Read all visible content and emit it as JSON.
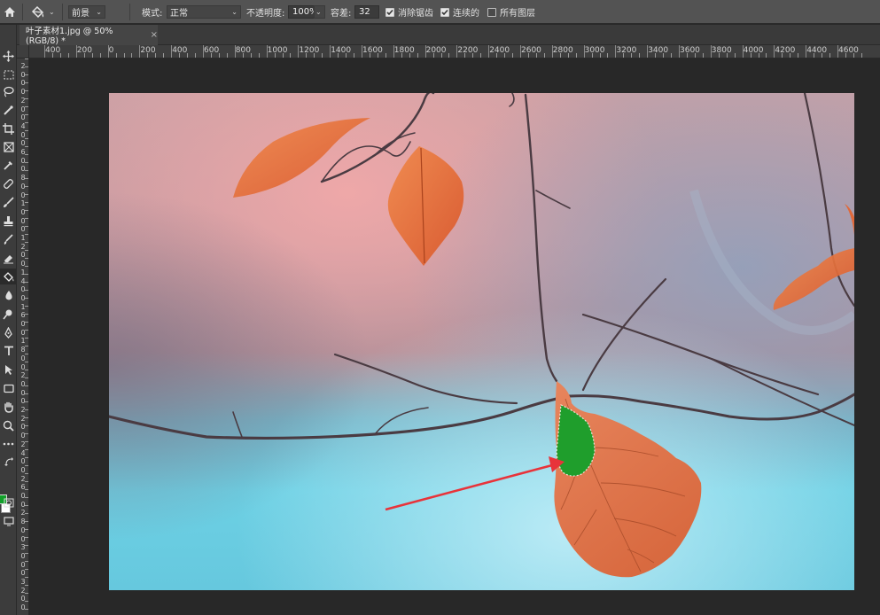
{
  "options_bar": {
    "home_icon": "home-icon",
    "tool_icon": "paint-bucket-icon",
    "fill_source": "前景",
    "mode_label": "模式:",
    "mode_value": "正常",
    "opacity_label": "不透明度:",
    "opacity_value": "100%",
    "tolerance_label": "容差:",
    "tolerance_value": "32",
    "anti_alias_label": "消除锯齿",
    "anti_alias_checked": true,
    "contiguous_label": "连续的",
    "contiguous_checked": true,
    "all_layers_label": "所有图层",
    "all_layers_checked": false
  },
  "document_tab": {
    "title": "叶子素材1.jpg @ 50%(RGB/8) *",
    "close": "×"
  },
  "ruler_h": [
    "400",
    "200",
    "0",
    "200",
    "400",
    "600",
    "800",
    "1000",
    "1200",
    "1400",
    "1600",
    "1800",
    "2000",
    "2200",
    "2400",
    "2600",
    "2800",
    "3000",
    "3200",
    "3400",
    "3600",
    "3800",
    "4000",
    "4200",
    "4400",
    "4600"
  ],
  "ruler_v": [
    "2",
    "0",
    "0",
    "0",
    "2",
    "0",
    "0",
    "4",
    "0",
    "0",
    "6",
    "0",
    "0",
    "8",
    "0",
    "0",
    "1",
    "0",
    "0",
    "0",
    "1",
    "2",
    "0",
    "0",
    "1",
    "4",
    "0",
    "0",
    "1",
    "6",
    "0",
    "0",
    "1",
    "8",
    "0",
    "0",
    "2",
    "0",
    "0",
    "0",
    "2",
    "2",
    "0",
    "0",
    "2",
    "4",
    "0",
    "0",
    "2",
    "6",
    "0",
    "0",
    "2",
    "8",
    "0",
    "0",
    "3",
    "0",
    "0",
    "0",
    "3",
    "2",
    "0",
    "0"
  ],
  "toolbar": {
    "tools": [
      "move-icon",
      "marquee-icon",
      "lasso-icon",
      "quick-select-icon",
      "crop-icon",
      "frame-icon",
      "eyedropper-icon",
      "healing-brush-icon",
      "brush-icon",
      "clone-stamp-icon",
      "history-brush-icon",
      "eraser-icon",
      "paint-bucket-icon",
      "blur-icon",
      "dodge-icon",
      "pen-icon",
      "type-icon",
      "path-select-icon",
      "rectangle-icon",
      "hand-icon",
      "zoom-icon",
      "more-tools-icon"
    ],
    "active_tool": "paint-bucket-icon",
    "foreground_color": "#12a02a",
    "background_color": "#ffffff"
  },
  "colors": {
    "fill_green": "#1f9e2c",
    "arrow_red": "#e8333a",
    "leaf_orange": "#e0693a"
  }
}
